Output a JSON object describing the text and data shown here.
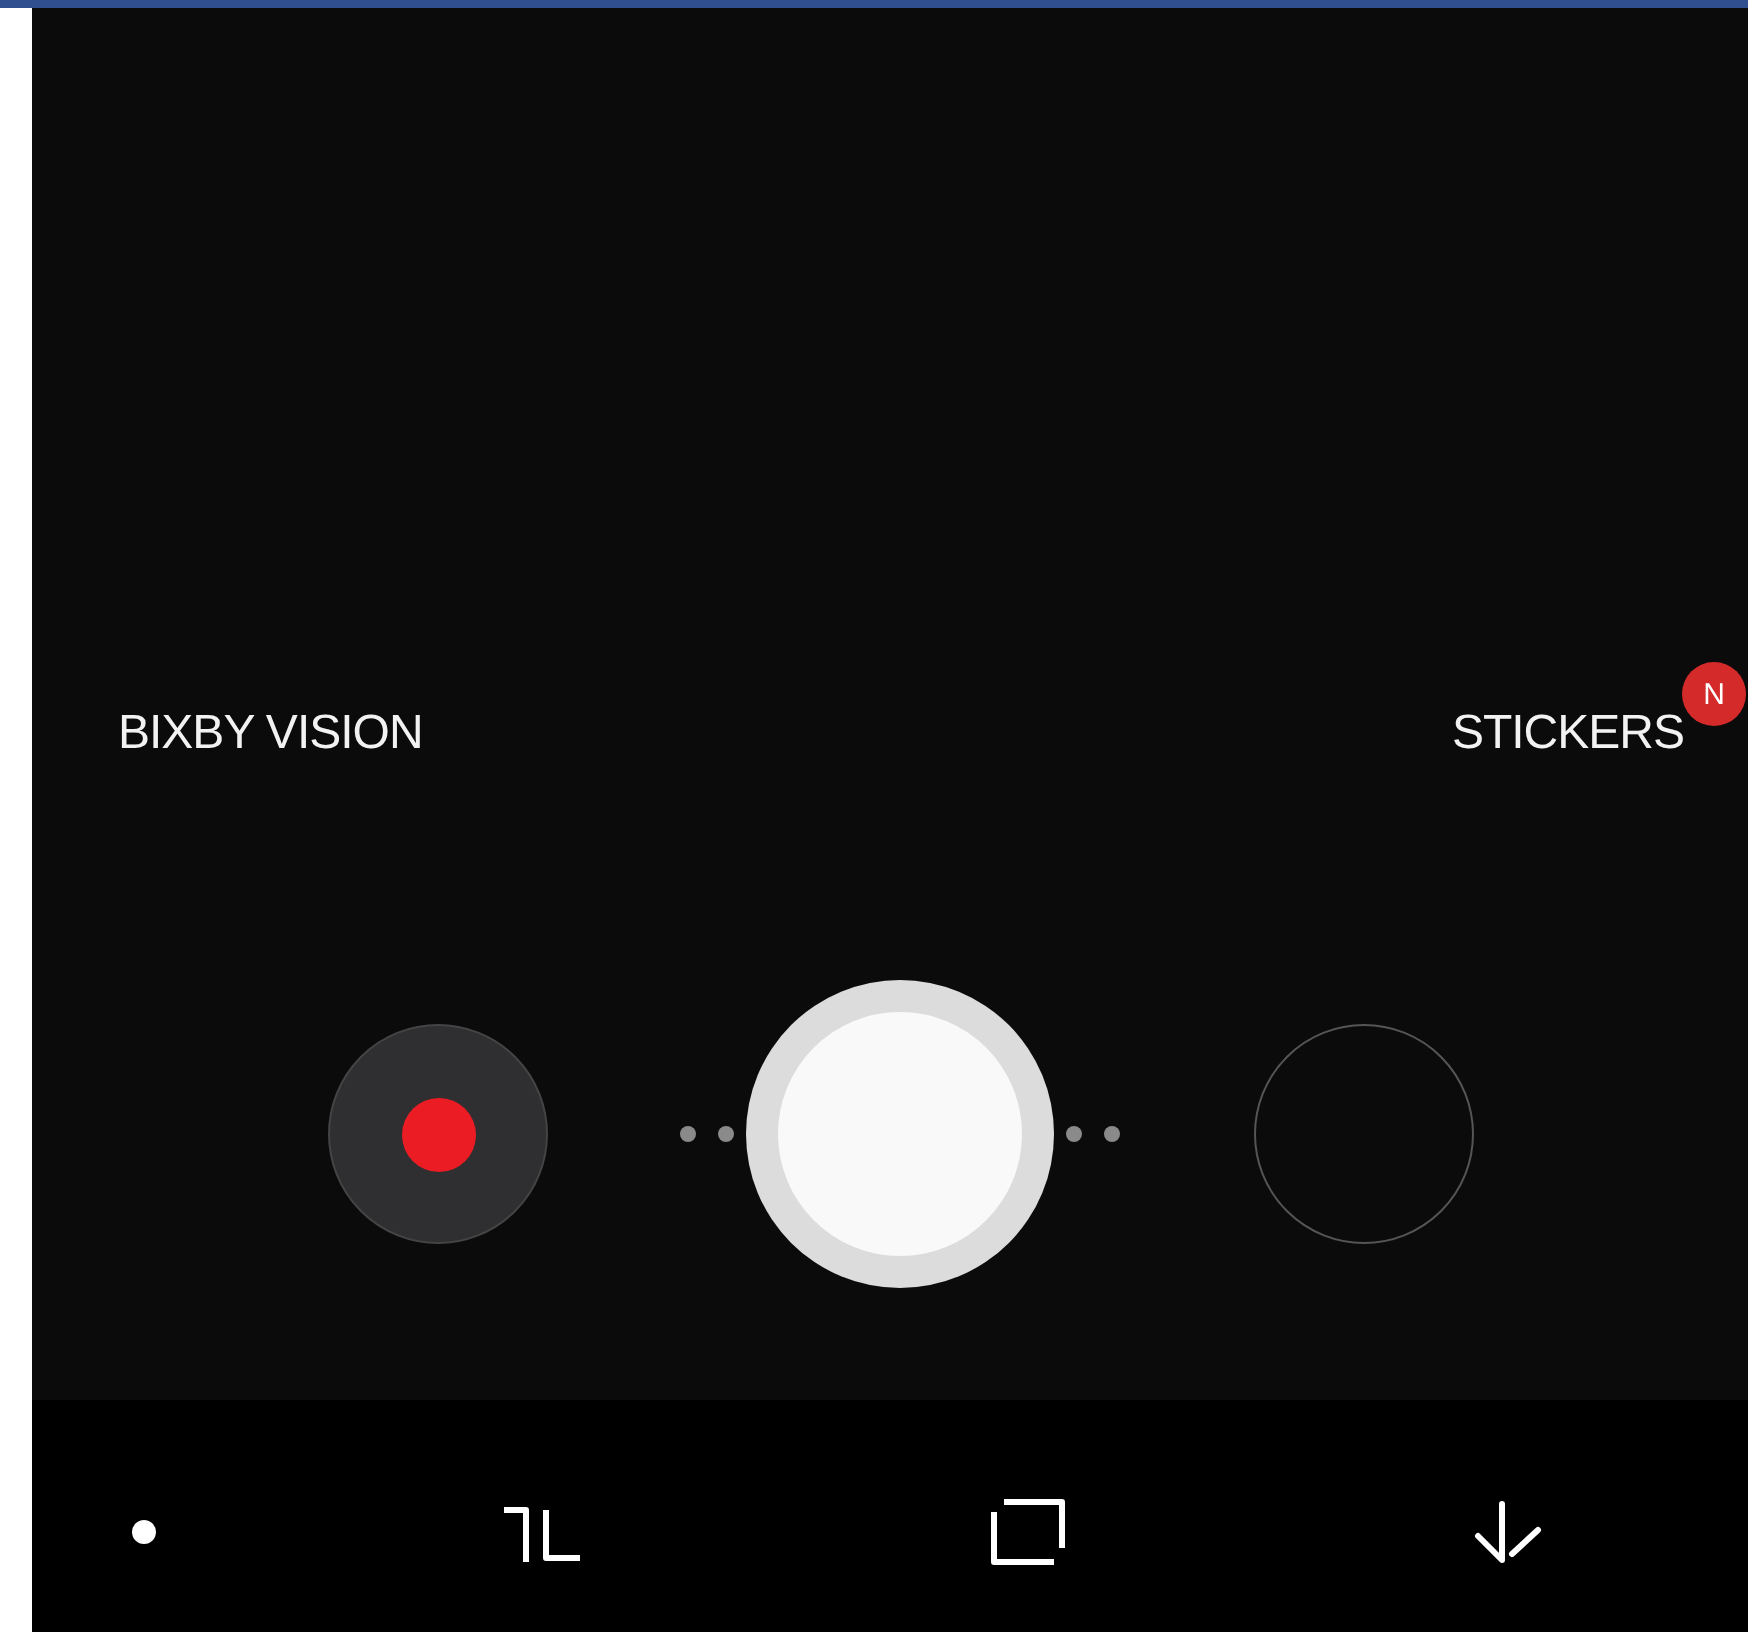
{
  "viewfinder": {
    "left_mode": {
      "label": "BIXBY VISION"
    },
    "right_mode": {
      "label": "STICKERS",
      "badge": "N"
    }
  }
}
